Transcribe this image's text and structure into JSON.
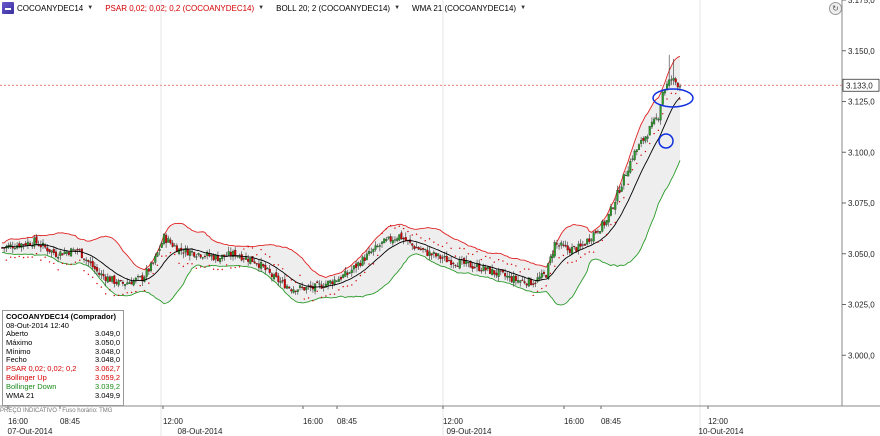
{
  "header": {
    "symbol": "COCOANYDEC14",
    "indicators": [
      {
        "label": "PSAR 0,02; 0,02; 0,2 (COCOANYDEC14)",
        "color": "#d40000"
      },
      {
        "label": "BOLL 20; 2 (COCOANYDEC14)",
        "color": "#000000"
      },
      {
        "label": "WMA 21 (COCOANYDEC14)",
        "color": "#000000"
      }
    ]
  },
  "infobox": {
    "title": "COCOANYDEC14 (Comprador)",
    "datetime": "08-Out-2014 12:40",
    "rows": [
      {
        "label": "Aberto",
        "value": "3.049,0"
      },
      {
        "label": "Máximo",
        "value": "3.050,0"
      },
      {
        "label": "Mínimo",
        "value": "3.048,0"
      },
      {
        "label": "Fecho",
        "value": "3.048,0"
      },
      {
        "label": "PSAR 0,02; 0,02; 0,2",
        "value": "3.062,7"
      },
      {
        "label": "Bollinger Up",
        "value": "3.059,2"
      },
      {
        "label": "Bollinger Down",
        "value": "3.039,2"
      },
      {
        "label": "WMA 21",
        "value": "3.049,9"
      }
    ]
  },
  "status_text": "PREÇO INDICATIVO · Fuso horário: TMG",
  "colors": {
    "bull": "#2a9a2a",
    "bear": "#d40000",
    "boll_up": "#e02020",
    "boll_down": "#2a9a2a",
    "wma": "#000000",
    "psar": "#d40000",
    "annot": "#1030e0"
  },
  "chart_data": {
    "type": "candlestick",
    "ylim": [
      2975,
      3175
    ],
    "y_ticks": [
      "3.175,0",
      "3.150,0",
      "3.125,0",
      "3.100,0",
      "3.075,0",
      "3.050,0",
      "3.025,0",
      "3.000,0"
    ],
    "current_price": 3133,
    "current_price_label": "3.133,0",
    "time_labels": [
      "16:00",
      "08:45",
      "12:00",
      "16:00",
      "08:45",
      "12:00",
      "16:00",
      "08:45",
      "12:00"
    ],
    "date_labels": [
      "07-Out-2014",
      "08-Out-2014",
      "09-Out-2014",
      "10-Out-2014"
    ],
    "close_anchors": [
      [
        0,
        3053
      ],
      [
        15,
        3056
      ],
      [
        25,
        3050
      ],
      [
        35,
        3052
      ],
      [
        45,
        3040
      ],
      [
        55,
        3035
      ],
      [
        65,
        3038
      ],
      [
        70,
        3045
      ],
      [
        75,
        3058
      ],
      [
        82,
        3052
      ],
      [
        92,
        3050
      ],
      [
        100,
        3048
      ],
      [
        108,
        3050
      ],
      [
        118,
        3046
      ],
      [
        126,
        3038
      ],
      [
        134,
        3033
      ],
      [
        144,
        3033
      ],
      [
        152,
        3036
      ],
      [
        160,
        3040
      ],
      [
        168,
        3048
      ],
      [
        176,
        3055
      ],
      [
        184,
        3059
      ],
      [
        190,
        3054
      ],
      [
        198,
        3050
      ],
      [
        206,
        3047
      ],
      [
        214,
        3045
      ],
      [
        222,
        3043
      ],
      [
        230,
        3040
      ],
      [
        238,
        3037
      ],
      [
        246,
        3036
      ],
      [
        252,
        3040
      ],
      [
        256,
        3055
      ],
      [
        262,
        3052
      ],
      [
        268,
        3053
      ],
      [
        274,
        3060
      ],
      [
        280,
        3066
      ],
      [
        286,
        3082
      ],
      [
        292,
        3098
      ],
      [
        298,
        3108
      ],
      [
        304,
        3118
      ],
      [
        306,
        3130
      ],
      [
        310,
        3136
      ],
      [
        314,
        3133
      ]
    ]
  }
}
